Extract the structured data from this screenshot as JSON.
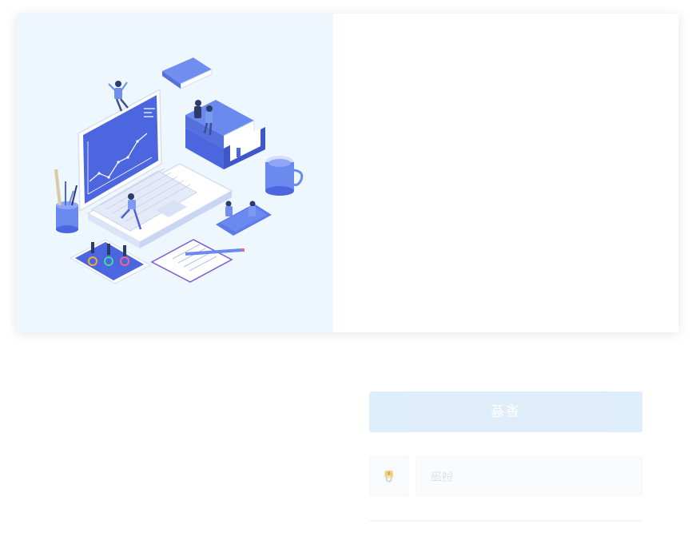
{
  "login": {
    "submit_label": "登录",
    "password_placeholder": "密码",
    "password_icon": "lock-icon"
  },
  "illustration": {
    "name": "isometric-laptop-analytics-illustration"
  },
  "colors": {
    "illustration_bg": "#eef6fe",
    "primary": "#4f6be3",
    "button_bg": "#dcecfb"
  }
}
